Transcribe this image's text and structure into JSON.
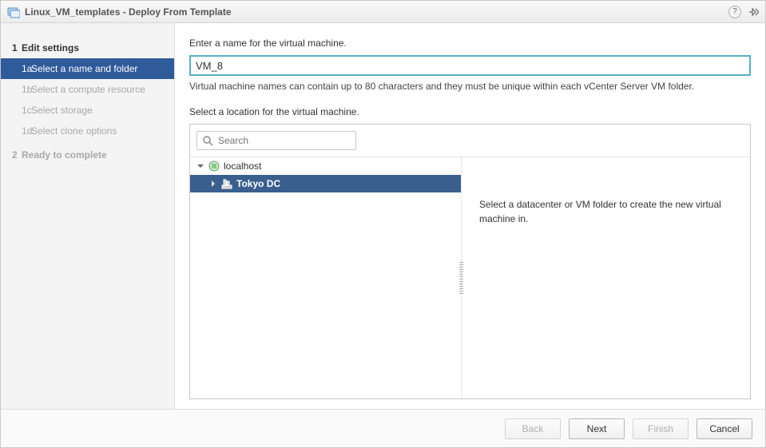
{
  "titlebar": {
    "vm_name": "Linux_VM_templates",
    "subtitle": "Deploy From Template"
  },
  "sidebar": {
    "step1": {
      "num": "1",
      "label": "Edit settings"
    },
    "step1a": {
      "num": "1a",
      "label": "Select a name and folder"
    },
    "step1b": {
      "num": "1b",
      "label": "Select a compute resource"
    },
    "step1c": {
      "num": "1c",
      "label": "Select storage"
    },
    "step1d": {
      "num": "1d",
      "label": "Select clone options"
    },
    "step2": {
      "num": "2",
      "label": "Ready to complete"
    }
  },
  "main": {
    "name_prompt": "Enter a name for the virtual machine.",
    "vm_name_value": "VM_8",
    "name_hint": "Virtual machine names can contain up to 80 characters and they must be unique within each vCenter Server VM folder.",
    "location_prompt": "Select a location for the virtual machine.",
    "search_placeholder": "Search",
    "tree": {
      "root": "localhost",
      "child": "Tokyo DC"
    },
    "desc": "Select a datacenter or VM folder to create the new virtual machine in."
  },
  "footer": {
    "back": "Back",
    "next": "Next",
    "finish": "Finish",
    "cancel": "Cancel"
  }
}
